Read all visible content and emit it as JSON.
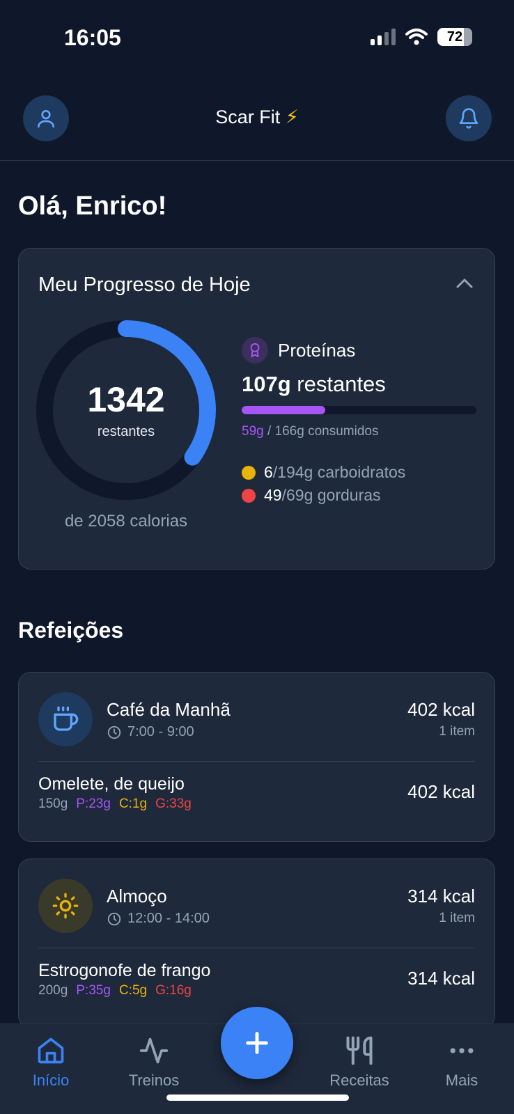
{
  "status_bar": {
    "time": "16:05",
    "battery": "72"
  },
  "header": {
    "title": "Scar Fit",
    "title_emoji": "⚡"
  },
  "greeting": "Olá, Enrico!",
  "progress": {
    "title": "Meu Progresso de Hoje",
    "calories_remaining": "1342",
    "remaining_label": "restantes",
    "calories_total_text": "de 2058 calorias",
    "calories_consumed_fraction": 0.348,
    "protein": {
      "label": "Proteínas",
      "remaining_value": "107g",
      "remaining_suffix": " restantes",
      "consumed": "59g",
      "consumed_suffix": " / 166g consumidos",
      "fill_fraction": 0.355,
      "color": "#a855f7"
    },
    "carbs": {
      "value": "6",
      "suffix": "/194g carboidratos",
      "color": "#eab308"
    },
    "fats": {
      "value": "49",
      "suffix": "/69g gorduras",
      "color": "#ef4444"
    }
  },
  "meals_title": "Refeições",
  "meals": [
    {
      "name": "Café da Manhã",
      "time": "7:00 - 9:00",
      "kcal": "402 kcal",
      "items_count": "1 item",
      "icon": "coffee-icon",
      "food": {
        "name": "Omelete, de queijo",
        "weight": "150g",
        "p": "P:23g",
        "c": "C:1g",
        "g": "G:33g",
        "kcal": "402 kcal"
      }
    },
    {
      "name": "Almoço",
      "time": "12:00 - 14:00",
      "kcal": "314 kcal",
      "items_count": "1 item",
      "icon": "sun-icon",
      "food": {
        "name": "Estrogonofe de frango",
        "weight": "200g",
        "p": "P:35g",
        "c": "C:5g",
        "g": "G:16g",
        "kcal": "314 kcal"
      }
    }
  ],
  "nav": [
    {
      "label": "Início",
      "icon": "home-icon",
      "active": true
    },
    {
      "label": "Treinos",
      "icon": "activity-icon",
      "active": false
    },
    {
      "label": "Receitas",
      "icon": "utensils-icon",
      "active": false
    },
    {
      "label": "Mais",
      "icon": "more-icon",
      "active": false
    }
  ],
  "colors": {
    "accent": "#3b82f6",
    "background": "#0f172a",
    "card": "#1e293b"
  }
}
